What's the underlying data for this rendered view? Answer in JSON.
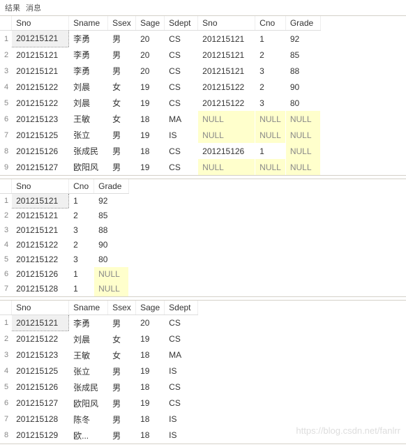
{
  "tabs": {
    "results": "结果",
    "messages": "消息"
  },
  "headers": {
    "Sno": "Sno",
    "Sname": "Sname",
    "Ssex": "Ssex",
    "Sage": "Sage",
    "Sdept": "Sdept",
    "Cno": "Cno",
    "Grade": "Grade"
  },
  "nullText": "NULL",
  "watermark": "https://blog.csdn.net/fanlrr",
  "grid1": {
    "cols": [
      "Sno",
      "Sname",
      "Ssex",
      "Sage",
      "Sdept",
      "Sno",
      "Cno",
      "Grade"
    ],
    "rows": [
      {
        "n": 1,
        "Sno": "201215121",
        "Sname": "李勇",
        "Ssex": "男",
        "Sage": "20",
        "Sdept": "CS",
        "Sno2": "201215121",
        "Cno": "1",
        "Grade": "92"
      },
      {
        "n": 2,
        "Sno": "201215121",
        "Sname": "李勇",
        "Ssex": "男",
        "Sage": "20",
        "Sdept": "CS",
        "Sno2": "201215121",
        "Cno": "2",
        "Grade": "85"
      },
      {
        "n": 3,
        "Sno": "201215121",
        "Sname": "李勇",
        "Ssex": "男",
        "Sage": "20",
        "Sdept": "CS",
        "Sno2": "201215121",
        "Cno": "3",
        "Grade": "88"
      },
      {
        "n": 4,
        "Sno": "201215122",
        "Sname": "刘晨",
        "Ssex": "女",
        "Sage": "19",
        "Sdept": "CS",
        "Sno2": "201215122",
        "Cno": "2",
        "Grade": "90"
      },
      {
        "n": 5,
        "Sno": "201215122",
        "Sname": "刘晨",
        "Ssex": "女",
        "Sage": "19",
        "Sdept": "CS",
        "Sno2": "201215122",
        "Cno": "3",
        "Grade": "80"
      },
      {
        "n": 6,
        "Sno": "201215123",
        "Sname": "王敏",
        "Ssex": "女",
        "Sage": "18",
        "Sdept": "MA",
        "Sno2": null,
        "Cno": null,
        "Grade": null
      },
      {
        "n": 7,
        "Sno": "201215125",
        "Sname": "张立",
        "Ssex": "男",
        "Sage": "19",
        "Sdept": "IS",
        "Sno2": null,
        "Cno": null,
        "Grade": null
      },
      {
        "n": 8,
        "Sno": "201215126",
        "Sname": "张成民",
        "Ssex": "男",
        "Sage": "18",
        "Sdept": "CS",
        "Sno2": "201215126",
        "Cno": "1",
        "Grade": null
      },
      {
        "n": 9,
        "Sno": "201215127",
        "Sname": "欧阳风",
        "Ssex": "男",
        "Sage": "19",
        "Sdept": "CS",
        "Sno2": null,
        "Cno": null,
        "Grade": null
      }
    ]
  },
  "grid2": {
    "cols": [
      "Sno",
      "Cno",
      "Grade"
    ],
    "rows": [
      {
        "n": 1,
        "Sno": "201215121",
        "Cno": "1",
        "Grade": "92"
      },
      {
        "n": 2,
        "Sno": "201215121",
        "Cno": "2",
        "Grade": "85"
      },
      {
        "n": 3,
        "Sno": "201215121",
        "Cno": "3",
        "Grade": "88"
      },
      {
        "n": 4,
        "Sno": "201215122",
        "Cno": "2",
        "Grade": "90"
      },
      {
        "n": 5,
        "Sno": "201215122",
        "Cno": "3",
        "Grade": "80"
      },
      {
        "n": 6,
        "Sno": "201215126",
        "Cno": "1",
        "Grade": null
      },
      {
        "n": 7,
        "Sno": "201215128",
        "Cno": "1",
        "Grade": null
      }
    ]
  },
  "grid3": {
    "cols": [
      "Sno",
      "Sname",
      "Ssex",
      "Sage",
      "Sdept"
    ],
    "rows": [
      {
        "n": 1,
        "Sno": "201215121",
        "Sname": "李勇",
        "Ssex": "男",
        "Sage": "20",
        "Sdept": "CS"
      },
      {
        "n": 2,
        "Sno": "201215122",
        "Sname": "刘晨",
        "Ssex": "女",
        "Sage": "19",
        "Sdept": "CS"
      },
      {
        "n": 3,
        "Sno": "201215123",
        "Sname": "王敏",
        "Ssex": "女",
        "Sage": "18",
        "Sdept": "MA"
      },
      {
        "n": 4,
        "Sno": "201215125",
        "Sname": "张立",
        "Ssex": "男",
        "Sage": "19",
        "Sdept": "IS"
      },
      {
        "n": 5,
        "Sno": "201215126",
        "Sname": "张成民",
        "Ssex": "男",
        "Sage": "18",
        "Sdept": "CS"
      },
      {
        "n": 6,
        "Sno": "201215127",
        "Sname": "欧阳风",
        "Ssex": "男",
        "Sage": "19",
        "Sdept": "CS"
      },
      {
        "n": 7,
        "Sno": "201215128",
        "Sname": "陈冬",
        "Ssex": "男",
        "Sage": "18",
        "Sdept": "IS"
      },
      {
        "n": 8,
        "Sno": "201215129",
        "Sname": "欧...",
        "Ssex": "男",
        "Sage": "18",
        "Sdept": "IS"
      }
    ]
  }
}
